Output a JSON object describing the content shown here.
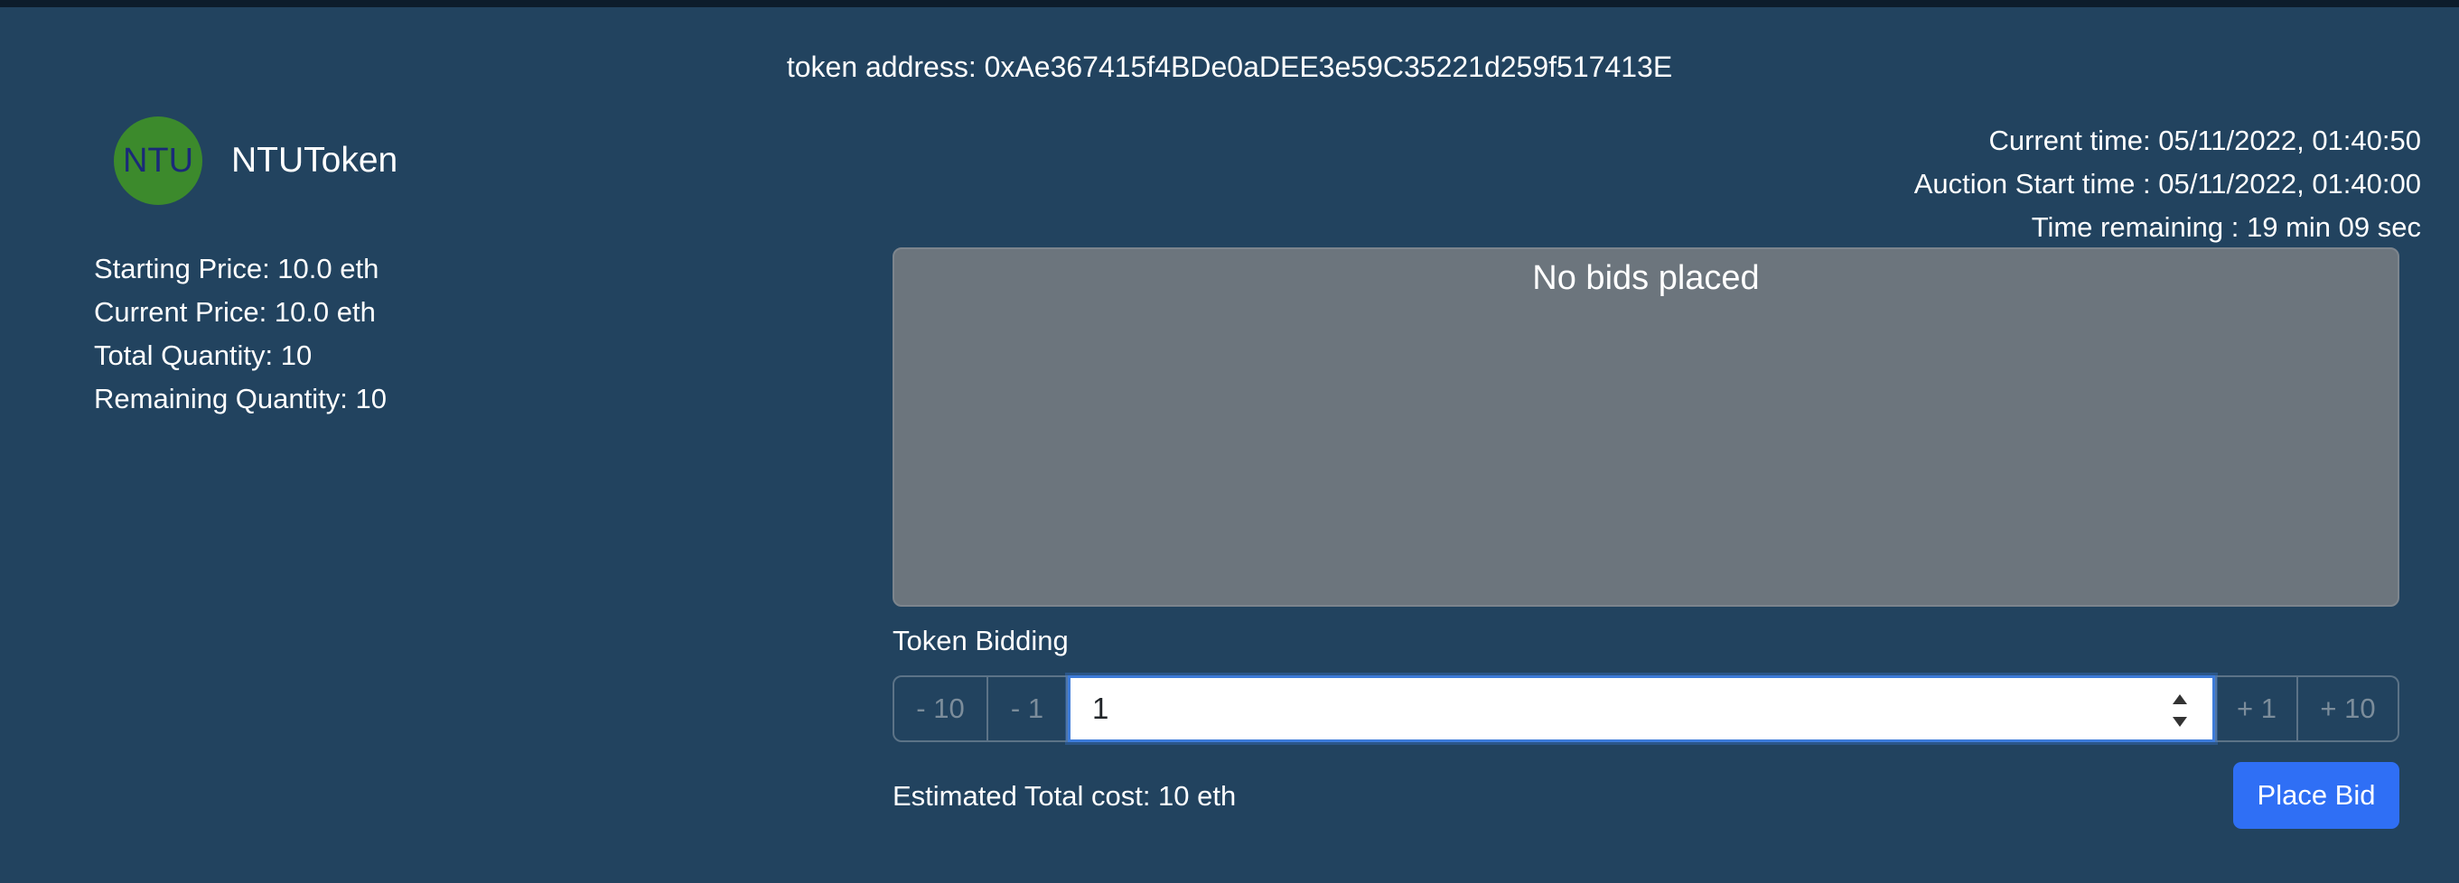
{
  "header": {
    "token_address": "token address: 0xAe367415f4BDe0aDEE3e59C35221d259f517413E"
  },
  "token": {
    "logo_text": "NTU",
    "name": "NTUToken"
  },
  "info": {
    "starting_price": "Starting Price: 10.0 eth",
    "current_price": "Current Price: 10.0 eth",
    "total_quantity": "Total Quantity: 10",
    "remaining_quantity": "Remaining Quantity: 10"
  },
  "times": {
    "current_time": "Current time: 05/11/2022, 01:40:50",
    "auction_start": "Auction Start time : 05/11/2022, 01:40:00",
    "time_remaining": "Time remaining : 19 min 09 sec"
  },
  "bids": {
    "empty_message": "No bids placed"
  },
  "bidding": {
    "label": "Token Bidding",
    "minus10": "- 10",
    "minus1": "- 1",
    "value": "1",
    "plus1": "+ 1",
    "plus10": "+ 10"
  },
  "footer": {
    "estimate": "Estimated Total cost: 10 eth",
    "place_bid": "Place Bid"
  },
  "colors": {
    "background": "#22435f",
    "logo": "#3c8a2c",
    "logo_text": "#1a2a78",
    "bids_panel": "#6c757d",
    "primary_button": "#2f6ff5"
  }
}
